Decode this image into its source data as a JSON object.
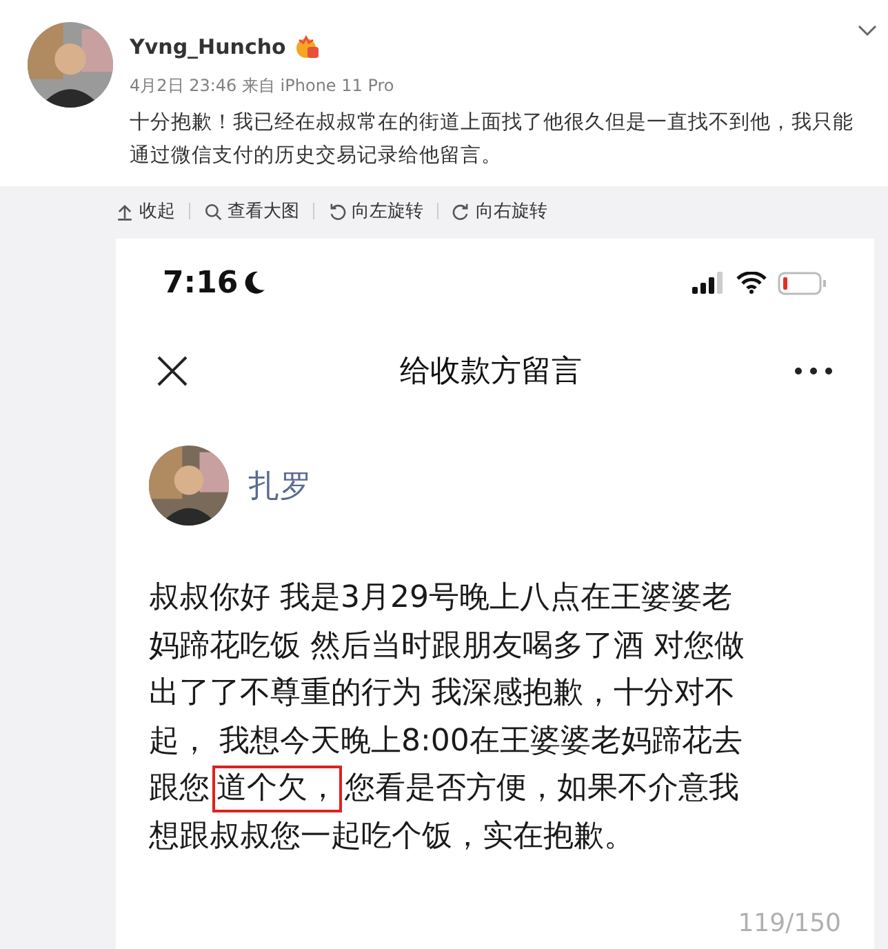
{
  "post": {
    "author": "Yvng_Huncho",
    "meta": "4月2日 23:46 来自 iPhone 11 Pro",
    "text": "十分抱歉！我已经在叔叔常在的街道上面找了他很久但是一直找不到他，我只能通过微信支付的历史交易记录给他留言。"
  },
  "toolbar": [
    {
      "kind": "collapse",
      "label": "收起"
    },
    {
      "kind": "zoom",
      "label": "查看大图"
    },
    {
      "kind": "rotate_left",
      "label": "向左旋转"
    },
    {
      "kind": "rotate_right",
      "label": "向右旋转"
    }
  ],
  "phone": {
    "time": "7:16",
    "title": "给收款方留言",
    "recipient": "扎罗",
    "message_lines": [
      {
        "text": "叔叔你好 我是3月29号晚上八点在王婆婆老"
      },
      {
        "text": "妈蹄花吃饭 然后当时跟朋友喝多了酒 对您做"
      },
      {
        "text": "出了了不尊重的行为 我深感抱歉，十分对不"
      },
      {
        "text": "起， 我想今天晚上8:00在王婆婆老妈蹄花去"
      },
      {
        "text": "跟您",
        "boxed": "道个欠，",
        "rest": "您看是否方便，如果不介意我"
      },
      {
        "text": "想跟叔叔您一起吃个饭，实在抱歉。"
      }
    ],
    "counter": "119/150"
  }
}
